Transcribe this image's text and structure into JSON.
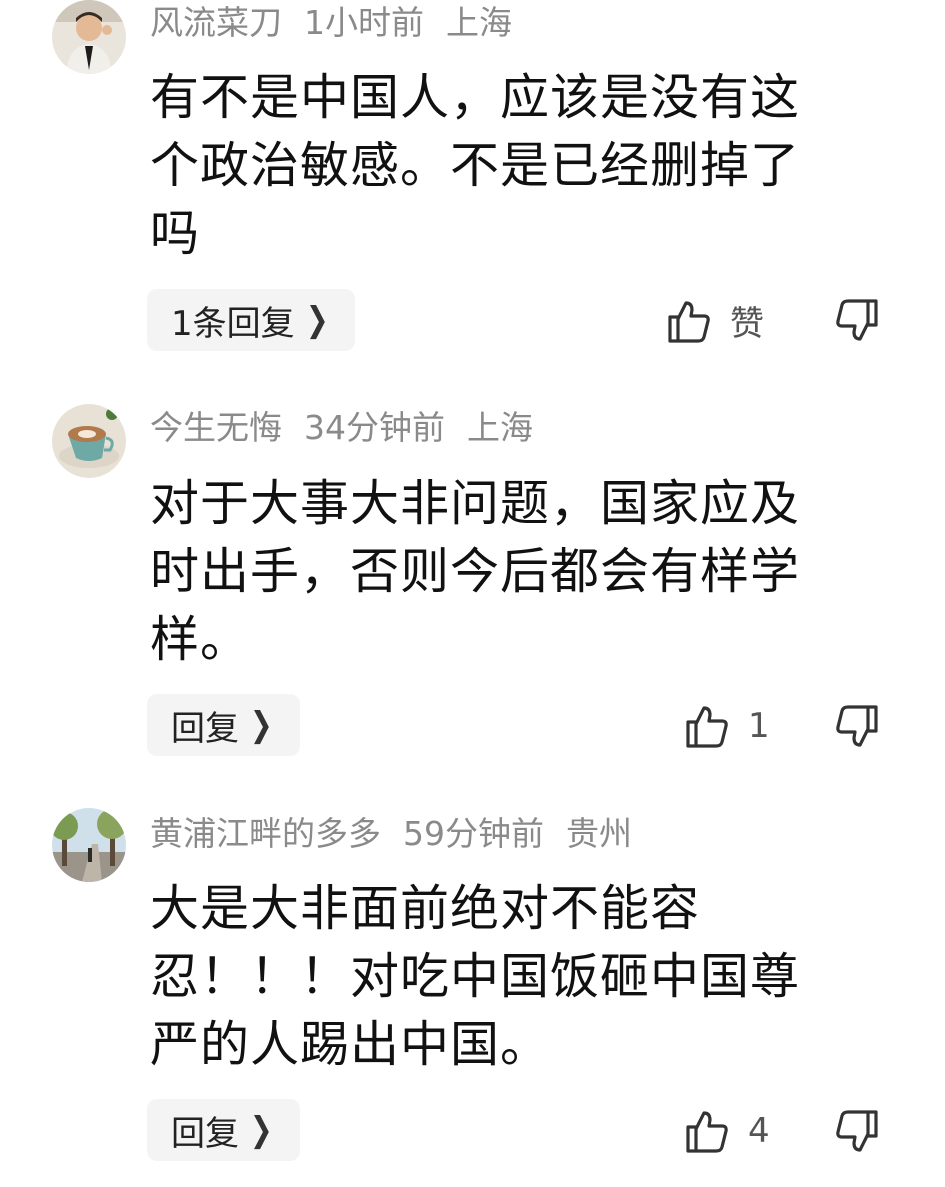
{
  "comments": [
    {
      "username": "风流菜刀",
      "time": "1小时前",
      "location": "上海",
      "lines": [
        "有不是中国人，应该是没有这",
        "个政治敏感。不是已经删掉了",
        "吗"
      ],
      "reply_label": "1条回复",
      "like_label": "赞",
      "avatar_icon": "child-portrait-avatar"
    },
    {
      "username": "今生无悔",
      "time": "34分钟前",
      "location": "上海",
      "lines": [
        "对于大事大非问题，国家应及",
        "时出手，否则今后都会有样学",
        "样。"
      ],
      "reply_label": "回复",
      "like_label": "1",
      "avatar_icon": "coffee-cup-avatar"
    },
    {
      "username": "黄浦江畔的多多",
      "time": "59分钟前",
      "location": "贵州",
      "lines": [
        "大是大非面前绝对不能容",
        "忍！！！对吃中国饭砸中国尊",
        "严的人踢出中国。"
      ],
      "reply_label": "回复",
      "like_label": "4",
      "avatar_icon": "street-scene-avatar"
    }
  ],
  "icons": {
    "like": "thumbs-up-icon",
    "dislike": "thumbs-down-icon",
    "chevron": "chevron-right-icon"
  },
  "colors": {
    "meta": "#8a8a8a",
    "reply_bg": "#f4f4f4",
    "text": "#111111"
  }
}
